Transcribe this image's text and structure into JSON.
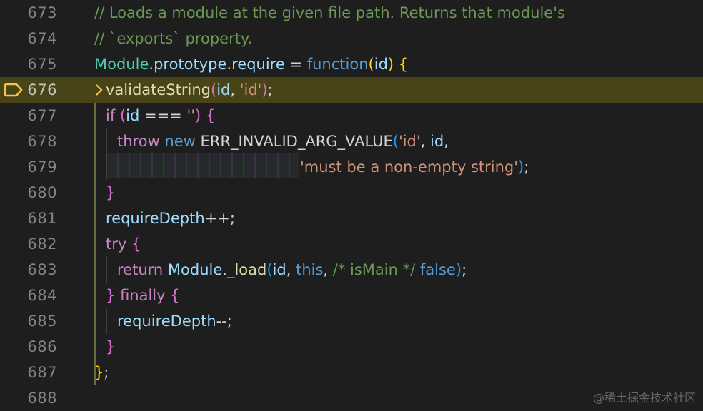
{
  "editor": {
    "lines": [
      {
        "num": "673",
        "tokens": [
          {
            "t": "// Loads a module at the given file path. Returns that module's",
            "c": "c-comment"
          }
        ]
      },
      {
        "num": "674",
        "tokens": [
          {
            "t": "// `exports` property.",
            "c": "c-comment"
          }
        ]
      },
      {
        "num": "675",
        "tokens": [
          {
            "t": "Module",
            "c": "c-type"
          },
          {
            "t": ".",
            "c": "c-plain"
          },
          {
            "t": "prototype",
            "c": "c-prop"
          },
          {
            "t": ".",
            "c": "c-plain"
          },
          {
            "t": "require",
            "c": "c-prop"
          },
          {
            "t": " = ",
            "c": "c-plain"
          },
          {
            "t": "function",
            "c": "c-kw"
          },
          {
            "t": "(",
            "c": "c-brk1"
          },
          {
            "t": "id",
            "c": "c-var"
          },
          {
            "t": ")",
            "c": "c-brk1"
          },
          {
            "t": " ",
            "c": "c-plain"
          },
          {
            "t": "{",
            "c": "c-brk1"
          }
        ]
      },
      {
        "num": "676",
        "tokens": [
          {
            "t": "validateString",
            "c": "c-fn"
          },
          {
            "t": "(",
            "c": "c-brk2"
          },
          {
            "t": "id",
            "c": "c-var"
          },
          {
            "t": ", ",
            "c": "c-plain"
          },
          {
            "t": "'id'",
            "c": "c-str"
          },
          {
            "t": ")",
            "c": "c-brk2"
          },
          {
            "t": ";",
            "c": "c-plain"
          }
        ]
      },
      {
        "num": "677",
        "tokens": [
          {
            "t": "if",
            "c": "c-ctrl"
          },
          {
            "t": " ",
            "c": "c-plain"
          },
          {
            "t": "(",
            "c": "c-brk2"
          },
          {
            "t": "id",
            "c": "c-var"
          },
          {
            "t": " === ",
            "c": "c-plain"
          },
          {
            "t": "''",
            "c": "c-str"
          },
          {
            "t": ")",
            "c": "c-brk2"
          },
          {
            "t": " ",
            "c": "c-plain"
          },
          {
            "t": "{",
            "c": "c-brk2"
          }
        ]
      },
      {
        "num": "678",
        "tokens": [
          {
            "t": "throw",
            "c": "c-ctrl"
          },
          {
            "t": " ",
            "c": "c-plain"
          },
          {
            "t": "new",
            "c": "c-kw"
          },
          {
            "t": " ERR_INVALID_ARG_VALUE",
            "c": "c-plain"
          },
          {
            "t": "(",
            "c": "c-brk3"
          },
          {
            "t": "'id'",
            "c": "c-str"
          },
          {
            "t": ", ",
            "c": "c-plain"
          },
          {
            "t": "id",
            "c": "c-var"
          },
          {
            "t": ",",
            "c": "c-plain"
          }
        ]
      },
      {
        "num": "679",
        "tokens": [
          {
            "t": "'must be a non-empty string'",
            "c": "c-str"
          },
          {
            "t": ")",
            "c": "c-brk3"
          },
          {
            "t": ";",
            "c": "c-plain"
          }
        ]
      },
      {
        "num": "680",
        "tokens": [
          {
            "t": "}",
            "c": "c-brk2"
          }
        ]
      },
      {
        "num": "681",
        "tokens": [
          {
            "t": "requireDepth",
            "c": "c-var"
          },
          {
            "t": "++;",
            "c": "c-plain"
          }
        ]
      },
      {
        "num": "682",
        "tokens": [
          {
            "t": "try",
            "c": "c-ctrl"
          },
          {
            "t": " ",
            "c": "c-plain"
          },
          {
            "t": "{",
            "c": "c-brk2"
          }
        ]
      },
      {
        "num": "683",
        "tokens": [
          {
            "t": "return",
            "c": "c-ctrl"
          },
          {
            "t": " ",
            "c": "c-plain"
          },
          {
            "t": "Module",
            "c": "c-var"
          },
          {
            "t": ".",
            "c": "c-plain"
          },
          {
            "t": "_load",
            "c": "c-fn"
          },
          {
            "t": "(",
            "c": "c-brk3"
          },
          {
            "t": "id",
            "c": "c-var"
          },
          {
            "t": ", ",
            "c": "c-plain"
          },
          {
            "t": "this",
            "c": "c-kw"
          },
          {
            "t": ", ",
            "c": "c-plain"
          },
          {
            "t": "/* isMain */",
            "c": "c-comment"
          },
          {
            "t": " ",
            "c": "c-plain"
          },
          {
            "t": "false",
            "c": "c-kw"
          },
          {
            "t": ")",
            "c": "c-brk3"
          },
          {
            "t": ";",
            "c": "c-plain"
          }
        ]
      },
      {
        "num": "684",
        "tokens": [
          {
            "t": "}",
            "c": "c-brk2"
          },
          {
            "t": " ",
            "c": "c-plain"
          },
          {
            "t": "finally",
            "c": "c-ctrl"
          },
          {
            "t": " ",
            "c": "c-plain"
          },
          {
            "t": "{",
            "c": "c-brk2"
          }
        ]
      },
      {
        "num": "685",
        "tokens": [
          {
            "t": "requireDepth",
            "c": "c-var"
          },
          {
            "t": "--;",
            "c": "c-plain"
          }
        ]
      },
      {
        "num": "686",
        "tokens": [
          {
            "t": "}",
            "c": "c-brk2"
          }
        ]
      },
      {
        "num": "687",
        "tokens": [
          {
            "t": "}",
            "c": "c-brk1"
          },
          {
            "t": ";",
            "c": "c-plain"
          }
        ]
      },
      {
        "num": "688",
        "tokens": []
      }
    ],
    "current_line": "676",
    "breakpoint_line": "676",
    "breakpoint_color": "#f2c744",
    "highlight_color": "#494418"
  },
  "watermark": "@稀土掘金技术社区"
}
